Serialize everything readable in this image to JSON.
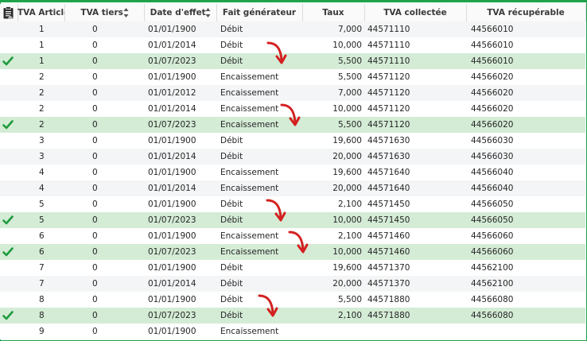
{
  "columns": {
    "article": "TVA Article",
    "tiers": "TVA tiers",
    "date": "Date d'effet",
    "fait": "Fait générateur",
    "taux": "Taux",
    "collectee": "TVA collectée",
    "recuperable": "TVA récupérable"
  },
  "rows": [
    {
      "article": "1",
      "tiers": "0",
      "date": "01/01/1900",
      "fait": "Débit",
      "taux": "7,000",
      "collectee": "44571110",
      "recuperable": "44566010",
      "checked": false
    },
    {
      "article": "1",
      "tiers": "0",
      "date": "01/01/2014",
      "fait": "Débit",
      "taux": "10,000",
      "collectee": "44571110",
      "recuperable": "44566010",
      "checked": false
    },
    {
      "article": "1",
      "tiers": "0",
      "date": "01/07/2023",
      "fait": "Débit",
      "taux": "5,500",
      "collectee": "44571110",
      "recuperable": "44566010",
      "checked": true
    },
    {
      "article": "2",
      "tiers": "0",
      "date": "01/01/1900",
      "fait": "Encaissement",
      "taux": "5,500",
      "collectee": "44571120",
      "recuperable": "44566020",
      "checked": false
    },
    {
      "article": "2",
      "tiers": "0",
      "date": "01/01/2012",
      "fait": "Encaissement",
      "taux": "7,000",
      "collectee": "44571120",
      "recuperable": "44566020",
      "checked": false
    },
    {
      "article": "2",
      "tiers": "0",
      "date": "01/01/2014",
      "fait": "Encaissement",
      "taux": "10,000",
      "collectee": "44571120",
      "recuperable": "44566020",
      "checked": false
    },
    {
      "article": "2",
      "tiers": "0",
      "date": "01/07/2023",
      "fait": "Encaissement",
      "taux": "5,500",
      "collectee": "44571120",
      "recuperable": "44566020",
      "checked": true
    },
    {
      "article": "3",
      "tiers": "0",
      "date": "01/01/1900",
      "fait": "Débit",
      "taux": "19,600",
      "collectee": "44571630",
      "recuperable": "44566030",
      "checked": false
    },
    {
      "article": "3",
      "tiers": "0",
      "date": "01/01/2014",
      "fait": "Débit",
      "taux": "20,000",
      "collectee": "44571630",
      "recuperable": "44566030",
      "checked": false
    },
    {
      "article": "4",
      "tiers": "0",
      "date": "01/01/1900",
      "fait": "Encaissement",
      "taux": "19,600",
      "collectee": "44571640",
      "recuperable": "44566040",
      "checked": false
    },
    {
      "article": "4",
      "tiers": "0",
      "date": "01/01/2014",
      "fait": "Encaissement",
      "taux": "20,000",
      "collectee": "44571640",
      "recuperable": "44566040",
      "checked": false
    },
    {
      "article": "5",
      "tiers": "0",
      "date": "01/01/1900",
      "fait": "Débit",
      "taux": "2,100",
      "collectee": "44571450",
      "recuperable": "44566050",
      "checked": false
    },
    {
      "article": "5",
      "tiers": "0",
      "date": "01/07/2023",
      "fait": "Débit",
      "taux": "10,000",
      "collectee": "44571450",
      "recuperable": "44566050",
      "checked": true
    },
    {
      "article": "6",
      "tiers": "0",
      "date": "01/01/1900",
      "fait": "Encaissement",
      "taux": "2,100",
      "collectee": "44571460",
      "recuperable": "44566060",
      "checked": false
    },
    {
      "article": "6",
      "tiers": "0",
      "date": "01/07/2023",
      "fait": "Encaissement",
      "taux": "10,000",
      "collectee": "44571460",
      "recuperable": "44566060",
      "checked": true
    },
    {
      "article": "7",
      "tiers": "0",
      "date": "01/01/1900",
      "fait": "Débit",
      "taux": "19,600",
      "collectee": "44571370",
      "recuperable": "44562100",
      "checked": false
    },
    {
      "article": "7",
      "tiers": "0",
      "date": "01/01/2014",
      "fait": "Débit",
      "taux": "20,000",
      "collectee": "44571370",
      "recuperable": "44562100",
      "checked": false
    },
    {
      "article": "8",
      "tiers": "0",
      "date": "01/01/1900",
      "fait": "Débit",
      "taux": "5,500",
      "collectee": "44571880",
      "recuperable": "44566080",
      "checked": false
    },
    {
      "article": "8",
      "tiers": "0",
      "date": "01/07/2023",
      "fait": "Débit",
      "taux": "2,100",
      "collectee": "44571880",
      "recuperable": "44566080",
      "checked": true
    },
    {
      "article": "9",
      "tiers": "0",
      "date": "01/01/1900",
      "fait": "Encaissement",
      "taux": "",
      "collectee": "",
      "recuperable": "",
      "checked": false
    }
  ],
  "colors": {
    "frame": "#1fa34a",
    "highlight_row": "#d4ecd6",
    "check": "#1e9a3c",
    "annotation_arrow": "#d42020"
  },
  "icons": {
    "header_corner": "clipboard-icon",
    "sort": "sort-arrows-icon",
    "row_marker": "checkmark-icon",
    "annotation": "curved-arrow-icon"
  }
}
